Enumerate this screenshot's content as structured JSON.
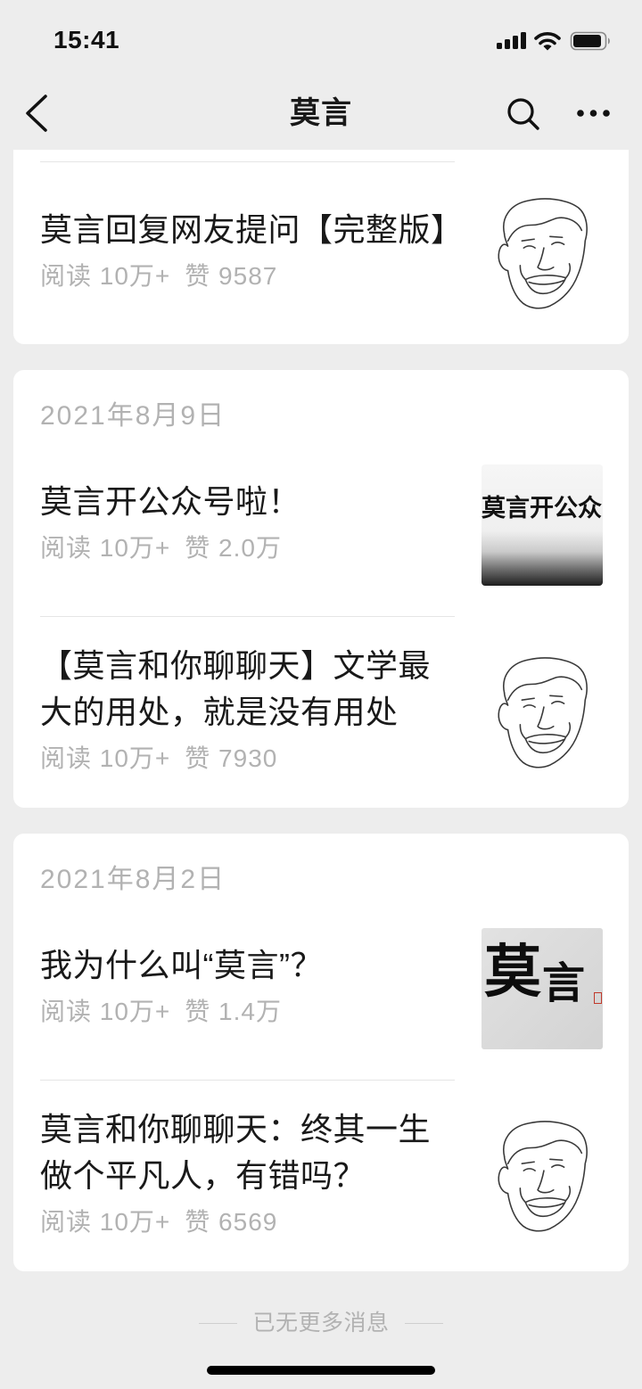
{
  "theme": {
    "page_bg": "#ededed",
    "card_bg": "#ffffff",
    "title_color": "#191919",
    "meta_color": "#b2b2b2",
    "divider_color": "#e5e5e5",
    "icon_color": "#111111"
  },
  "status_bar": {
    "time": "15:41",
    "icons": [
      "signal-icon",
      "wifi-icon",
      "battery-icon"
    ]
  },
  "nav": {
    "title": "莫言",
    "icons": {
      "back": "chevron-left-icon",
      "search": "search-icon",
      "more": "more-icon"
    }
  },
  "cards": [
    {
      "articles": [
        {
          "title": "莫言回复网友提问【完整版】",
          "reads": "阅读 10万+",
          "likes": "赞 9587"
        }
      ]
    },
    {
      "date": "2021年8月9日",
      "articles": [
        {
          "title": "莫言开公众号啦！",
          "reads": "阅读 10万+",
          "likes": "赞 2.0万",
          "cover_text": "莫言开公众"
        },
        {
          "title": "【莫言和你聊聊天】文学最大的用处，就是没有用处",
          "reads": "阅读 10万+",
          "likes": "赞 7930"
        }
      ]
    },
    {
      "date": "2021年8月2日",
      "articles": [
        {
          "title": "我为什么叫“莫言”？",
          "reads": "阅读 10万+",
          "likes": "赞 1.4万",
          "cover_text": [
            "莫",
            "言"
          ]
        },
        {
          "title": "莫言和你聊聊天：终其一生做个平凡人，有错吗？",
          "reads": "阅读 10万+",
          "likes": "赞 6569"
        }
      ]
    }
  ],
  "footer": {
    "end_text": "已无更多消息"
  }
}
